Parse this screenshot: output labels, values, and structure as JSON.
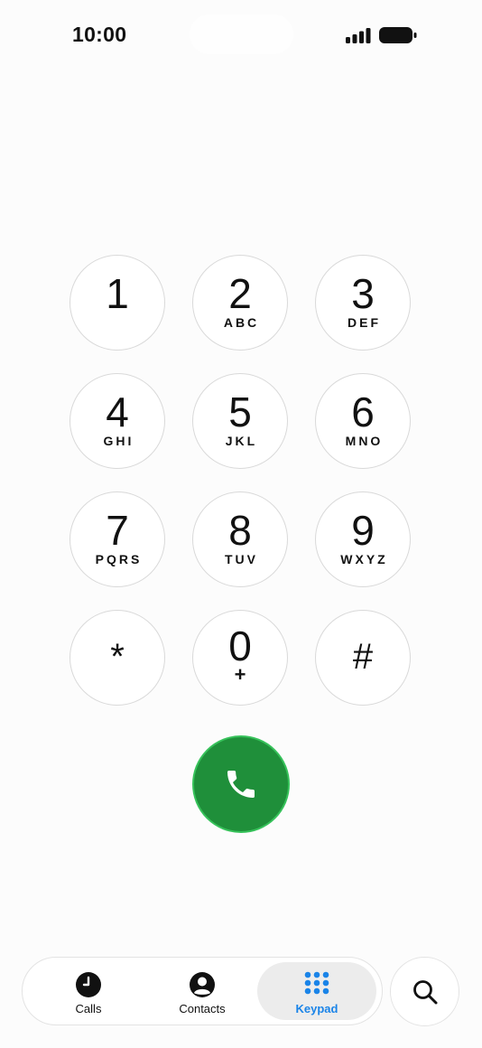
{
  "status_bar": {
    "time": "10:00"
  },
  "keypad": {
    "keys": [
      {
        "digit": "1",
        "letters": ""
      },
      {
        "digit": "2",
        "letters": "ABC"
      },
      {
        "digit": "3",
        "letters": "DEF"
      },
      {
        "digit": "4",
        "letters": "GHI"
      },
      {
        "digit": "5",
        "letters": "JKL"
      },
      {
        "digit": "6",
        "letters": "MNO"
      },
      {
        "digit": "7",
        "letters": "PQRS"
      },
      {
        "digit": "8",
        "letters": "TUV"
      },
      {
        "digit": "9",
        "letters": "WXYZ"
      },
      {
        "digit": "*",
        "letters": ""
      },
      {
        "digit": "0",
        "letters": "+"
      },
      {
        "digit": "#",
        "letters": ""
      }
    ]
  },
  "call": {
    "icon": "phone-icon",
    "color": "#1f8f3a"
  },
  "tabs": [
    {
      "label": "Calls",
      "icon": "clock-icon",
      "active": false
    },
    {
      "label": "Contacts",
      "icon": "person-icon",
      "active": false
    },
    {
      "label": "Keypad",
      "icon": "keypad-icon",
      "active": true
    }
  ],
  "search": {
    "icon": "search-icon"
  },
  "colors": {
    "accent": "#1a84e8",
    "call_green": "#1f8f3a"
  }
}
